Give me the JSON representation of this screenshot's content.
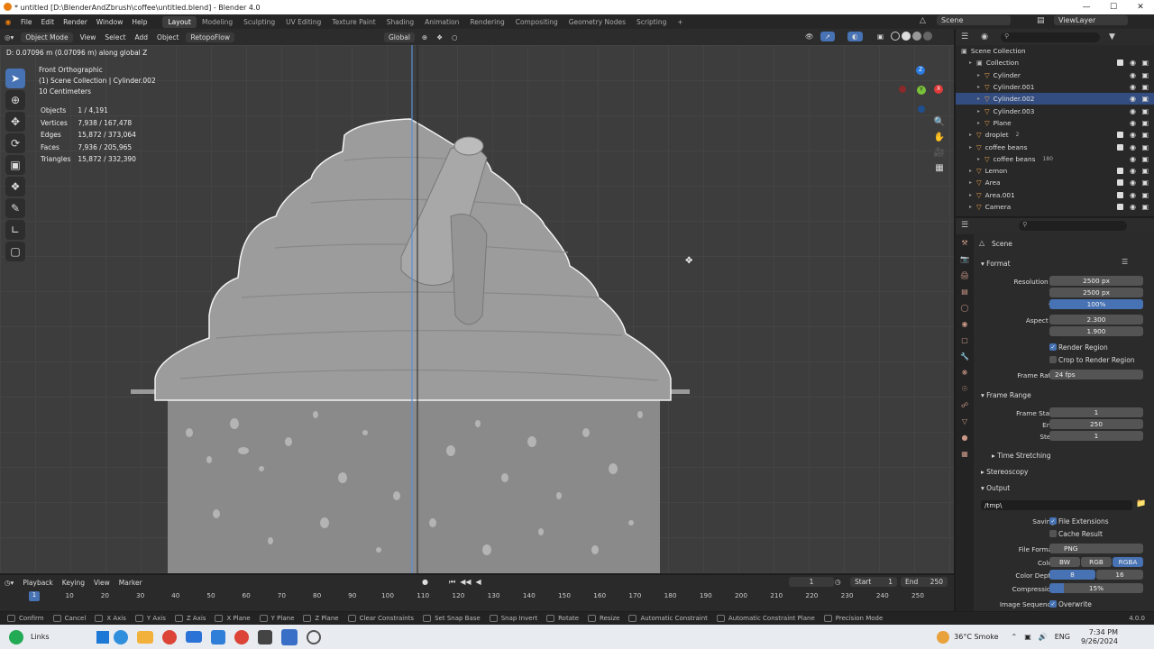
{
  "window": {
    "title": "* untitled [D:\\BlenderAndZbrush\\coffee\\untitled.blend] - Blender 4.0",
    "min": "—",
    "max": "☐",
    "close": "✕"
  },
  "menu": [
    "File",
    "Edit",
    "Render",
    "Window",
    "Help"
  ],
  "workspaces": [
    "Layout",
    "Modeling",
    "Sculpting",
    "UV Editing",
    "Texture Paint",
    "Shading",
    "Animation",
    "Rendering",
    "Compositing",
    "Geometry Nodes",
    "Scripting",
    "+"
  ],
  "scene_field": "Scene",
  "viewlayer_field": "ViewLayer",
  "viewport_header": {
    "mode": "Object Mode",
    "items": [
      "View",
      "Select",
      "Add",
      "Object",
      "RetopoFlow"
    ],
    "orientation": "Global"
  },
  "viewport": {
    "operator_info": "D: 0.07096 m (0.07096 m) along global Z",
    "view_name": "Front Orthographic",
    "collection_line": "(1) Scene Collection | Cylinder.002",
    "scale": "10 Centimeters",
    "stats": [
      {
        "label": "Objects",
        "value": "1 / 4,191"
      },
      {
        "label": "Vertices",
        "value": "7,938 / 167,478"
      },
      {
        "label": "Edges",
        "value": "15,872 / 373,064"
      },
      {
        "label": "Faces",
        "value": "7,936 / 205,965"
      },
      {
        "label": "Triangles",
        "value": "15,872 / 332,390"
      }
    ],
    "gizmo_axes": [
      "X",
      "Y",
      "Z"
    ]
  },
  "outliner": {
    "root": "Scene Collection",
    "rows": [
      {
        "label": "Collection",
        "indent": 1,
        "selected": false
      },
      {
        "label": "Cylinder",
        "indent": 2,
        "selected": false
      },
      {
        "label": "Cylinder.001",
        "indent": 2,
        "selected": false
      },
      {
        "label": "Cylinder.002",
        "indent": 2,
        "selected": true
      },
      {
        "label": "Cylinder.003",
        "indent": 2,
        "selected": false
      },
      {
        "label": "Plane",
        "indent": 2,
        "selected": false
      },
      {
        "label": "droplet",
        "indent": 1,
        "selected": false,
        "badge": "2"
      },
      {
        "label": "coffee beans",
        "indent": 1,
        "selected": false
      },
      {
        "label": "coffee beans",
        "indent": 2,
        "selected": false,
        "badge": "180"
      },
      {
        "label": "Lemon",
        "indent": 1,
        "selected": false
      },
      {
        "label": "Area",
        "indent": 1,
        "selected": false
      },
      {
        "label": "Area.001",
        "indent": 1,
        "selected": false
      },
      {
        "label": "Camera",
        "indent": 1,
        "selected": false
      }
    ]
  },
  "properties": {
    "context": "Scene",
    "format": {
      "title": "Format",
      "resolution_x_label": "Resolution X",
      "resolution_x": "2500 px",
      "y_label": "Y",
      "resolution_y": "2500 px",
      "pct_label": "%",
      "resolution_pct": "100%",
      "aspect_x_label": "Aspect X",
      "aspect_x": "2.300",
      "aspect_y_label": "Y",
      "aspect_y": "1.900",
      "render_region": "Render Region",
      "crop_region": "Crop to Render Region",
      "frame_rate_label": "Frame Rate",
      "frame_rate": "24 fps"
    },
    "frame_range": {
      "title": "Frame Range",
      "start_label": "Frame Start",
      "start": "1",
      "end_label": "End",
      "end": "250",
      "step_label": "Step",
      "step": "1"
    },
    "time_stretching": "Time Stretching",
    "stereoscopy": "Stereoscopy",
    "output": {
      "title": "Output",
      "path": "/tmp\\",
      "saving_label": "Saving",
      "file_extensions": "File Extensions",
      "cache_result": "Cache Result",
      "file_format_label": "File Format",
      "file_format": "PNG",
      "color_label": "Color",
      "color_options": [
        "BW",
        "RGB",
        "RGBA"
      ],
      "color_depth_label": "Color Depth",
      "depth_options": [
        "8",
        "16"
      ],
      "compression_label": "Compression",
      "compression": "15%",
      "compression_fraction": 0.15,
      "image_sequence_label": "Image Sequence",
      "overwrite": "Overwrite"
    }
  },
  "timeline": {
    "menu": [
      "Playback",
      "Keying",
      "View",
      "Marker"
    ],
    "current_frame": "1",
    "start_label": "Start",
    "start": "1",
    "end_label": "End",
    "end": "250",
    "ticks": [
      "10",
      "20",
      "30",
      "40",
      "50",
      "60",
      "70",
      "80",
      "90",
      "100",
      "110",
      "120",
      "130",
      "140",
      "150",
      "160",
      "170",
      "180",
      "190",
      "200",
      "210",
      "220",
      "230",
      "240",
      "250"
    ],
    "cursor": "1"
  },
  "statusbar": {
    "items": [
      "Confirm",
      "Cancel",
      "X Axis",
      "Y Axis",
      "Z Axis",
      "X Plane",
      "Y Plane",
      "Z Plane",
      "Clear Constraints",
      "Set Snap Base",
      "Snap Invert",
      "Rotate",
      "Resize",
      "Automatic Constraint",
      "Automatic Constraint Plane",
      "Precision Mode"
    ],
    "version": "4.0.0"
  },
  "taskbar": {
    "start_label": "Links",
    "weather": "36°C  Smoke",
    "lang": "ENG",
    "time": "7:34 PM",
    "date": "9/26/2024"
  }
}
